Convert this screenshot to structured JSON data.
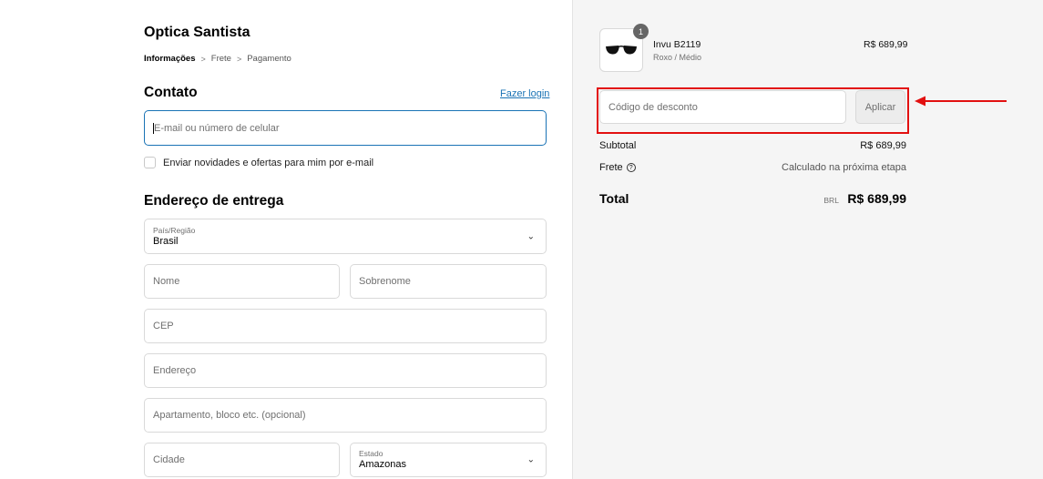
{
  "store": {
    "name": "Optica Santista"
  },
  "breadcrumb": {
    "step1": "Informações",
    "step2": "Frete",
    "step3": "Pagamento"
  },
  "contact": {
    "heading": "Contato",
    "login_link": "Fazer login",
    "email_placeholder": "E-mail ou número de celular",
    "newsletter_label": "Enviar novidades e ofertas para mim por e-mail"
  },
  "shipping": {
    "heading": "Endereço de entrega",
    "country_label": "País/Região",
    "country_value": "Brasil",
    "first_name_placeholder": "Nome",
    "last_name_placeholder": "Sobrenome",
    "cep_placeholder": "CEP",
    "address_placeholder": "Endereço",
    "apartment_placeholder": "Apartamento, bloco etc. (opcional)",
    "city_placeholder": "Cidade",
    "state_label": "Estado",
    "state_value": "Amazonas"
  },
  "summary": {
    "item": {
      "quantity": "1",
      "name": "Invu B2119",
      "variant": "Roxo / Médio",
      "price": "R$ 689,99"
    },
    "discount": {
      "placeholder": "Código de desconto",
      "apply_label": "Aplicar"
    },
    "subtotal_label": "Subtotal",
    "subtotal_value": "R$ 689,99",
    "shipping_label": "Frete",
    "shipping_value": "Calculado na próxima etapa",
    "total_label": "Total",
    "total_currency": "BRL",
    "total_value": "R$ 689,99"
  },
  "colors": {
    "accent": "#1a73b5",
    "highlight": "#e21010",
    "sidebar_bg": "#f5f5f5"
  }
}
